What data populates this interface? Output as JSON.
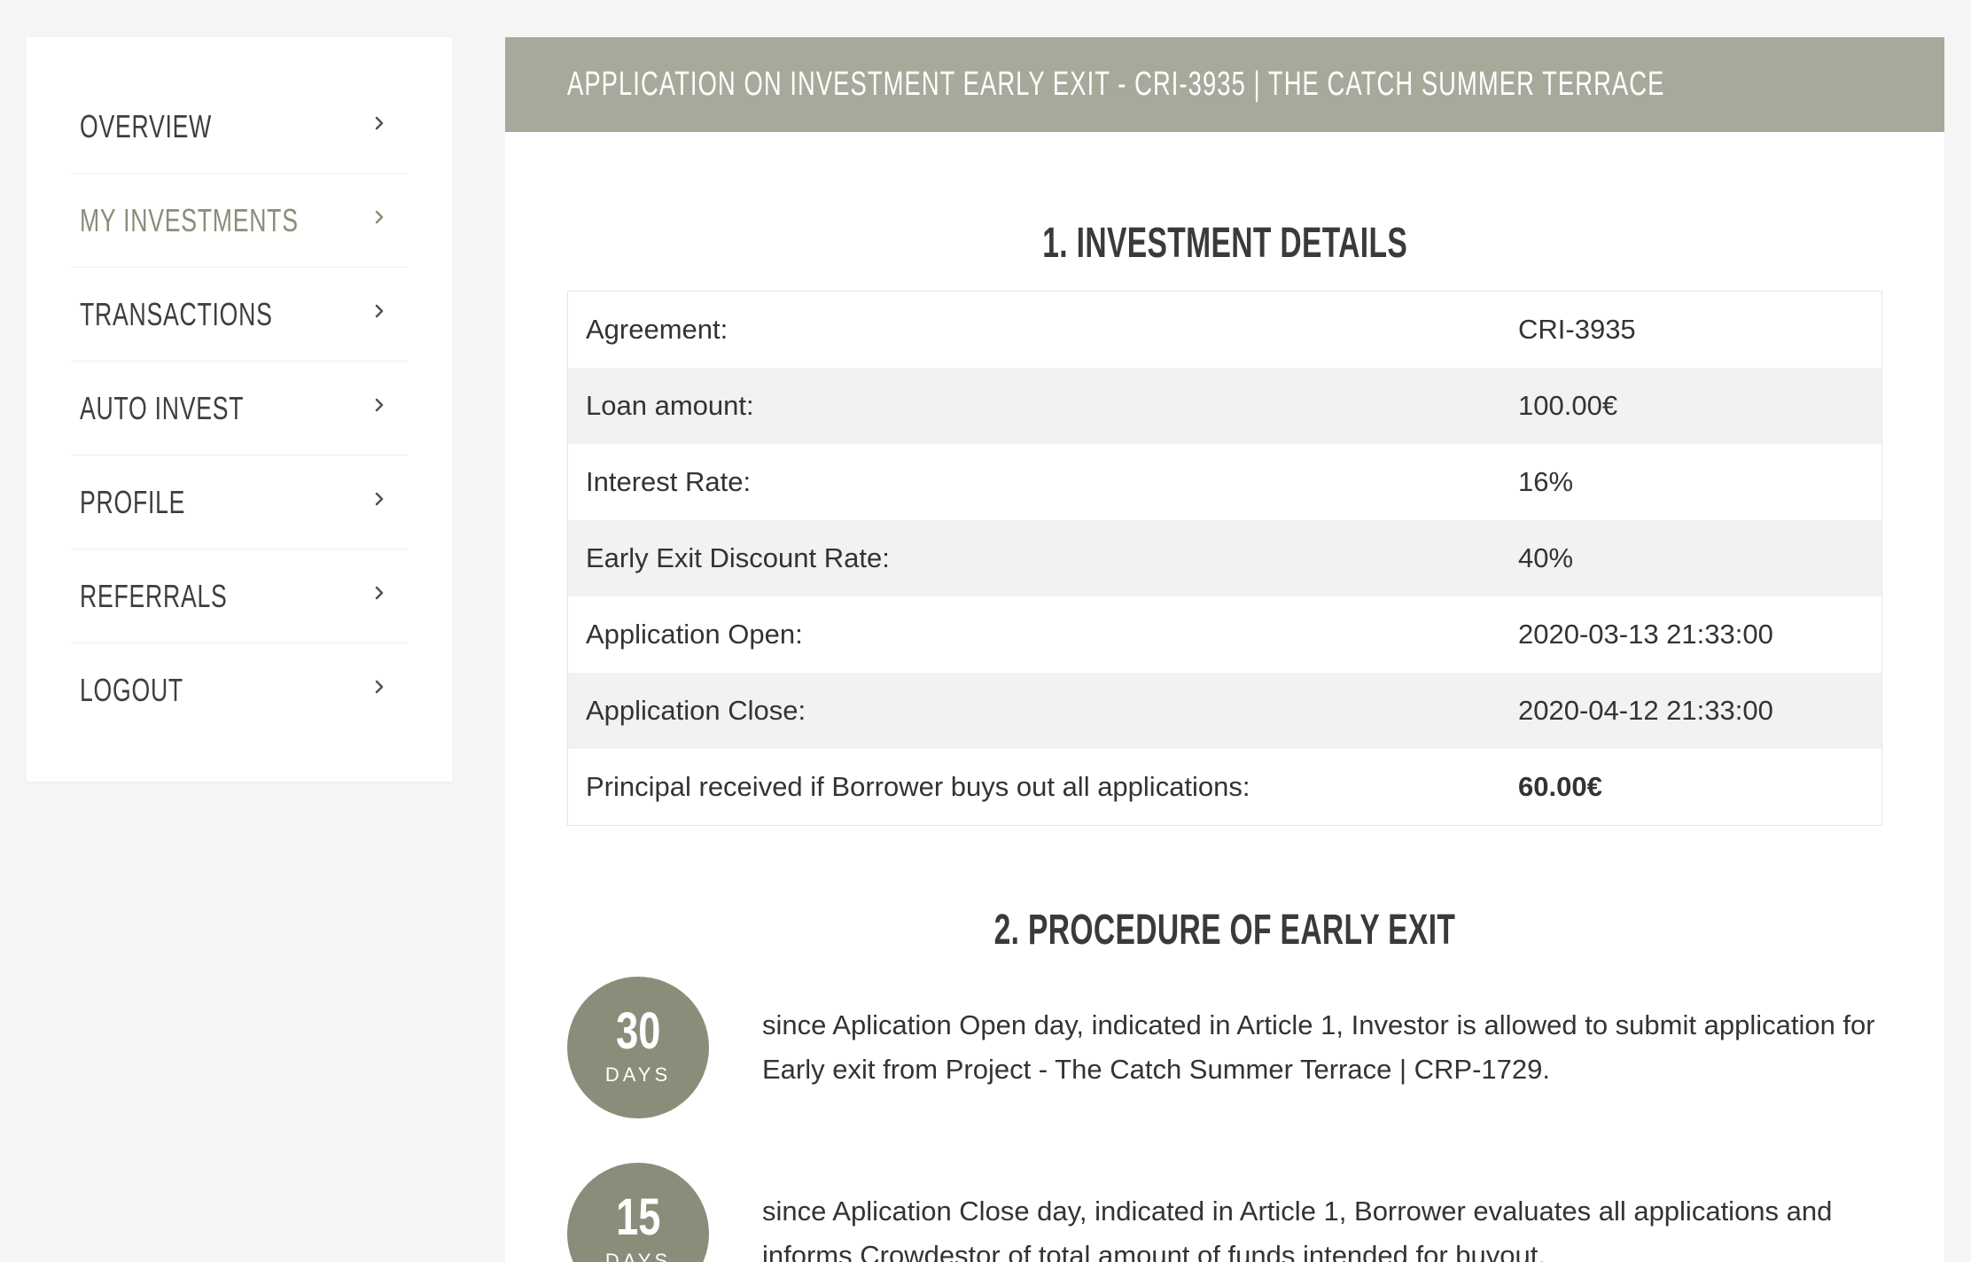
{
  "sidebar": {
    "items": [
      {
        "label": "Overview",
        "active": false
      },
      {
        "label": "My Investments",
        "active": true
      },
      {
        "label": "Transactions",
        "active": false
      },
      {
        "label": "Auto Invest",
        "active": false
      },
      {
        "label": "Profile",
        "active": false
      },
      {
        "label": "Referrals",
        "active": false
      },
      {
        "label": "Logout",
        "active": false
      }
    ]
  },
  "header": {
    "title": "Application on investment early exit - CRI-3935 | The Catch Summer Terrace"
  },
  "section1": {
    "title": "1. Investment details",
    "rows": [
      {
        "label": "Agreement:",
        "value": "CRI-3935"
      },
      {
        "label": "Loan amount:",
        "value": "100.00€"
      },
      {
        "label": "Interest Rate:",
        "value": "16%"
      },
      {
        "label": "Early Exit Discount Rate:",
        "value": "40%"
      },
      {
        "label": "Application Open:",
        "value": "2020-03-13 21:33:00"
      },
      {
        "label": "Application Close:",
        "value": "2020-04-12 21:33:00"
      },
      {
        "label": "Principal received if Borrower buys out all applications:",
        "value": "60.00€"
      }
    ]
  },
  "section2": {
    "title": "2. Procedure of early exit",
    "steps": [
      {
        "number": "30",
        "unit": "Days",
        "text": "since Aplication Open day, indicated in Article 1, Investor is allowed to submit application for Early exit from Project - The Catch Summer Terrace | CRP-1729."
      },
      {
        "number": "15",
        "unit": "Days",
        "text": "since Aplication Close day, indicated in Article 1, Borrower evaluates all applications and informs Crowdestor of total amount of funds intended for buyout."
      }
    ]
  },
  "colors": {
    "header_bg": "#a9a99b",
    "accent": "#8c8c7a",
    "page_bg": "#f5f5f5"
  },
  "icons": {
    "sidebar_chevron": "chevron-right-icon"
  }
}
